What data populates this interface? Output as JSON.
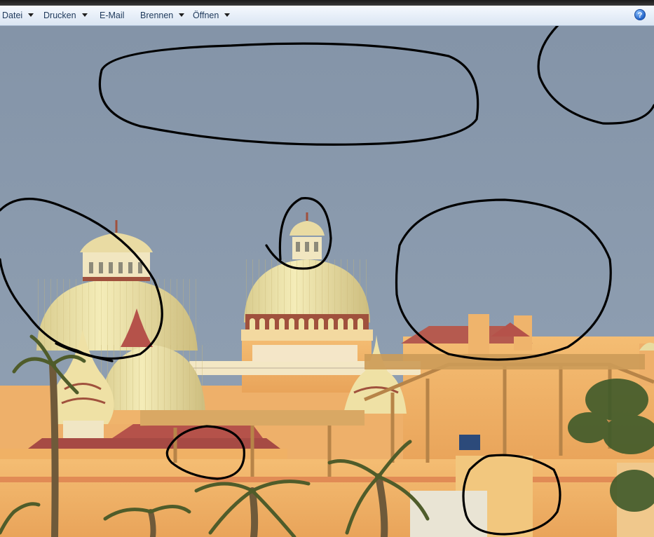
{
  "toolbar": {
    "items": [
      {
        "label": "Datei",
        "has_dropdown": true
      },
      {
        "label": "Drucken",
        "has_dropdown": true
      },
      {
        "label": "E-Mail",
        "has_dropdown": false
      },
      {
        "label": "Brennen",
        "has_dropdown": true
      },
      {
        "label": "Öffnen",
        "has_dropdown": true
      }
    ],
    "help_icon": "help-icon",
    "help_glyph": "?"
  },
  "viewer": {
    "image_icon": "photo-image",
    "colors": {
      "sky": "#8c9cb0",
      "dome": "#efe3a6",
      "wall": "#f2b56a",
      "roof": "#b5524a",
      "annotation_ink": "#000000"
    }
  }
}
